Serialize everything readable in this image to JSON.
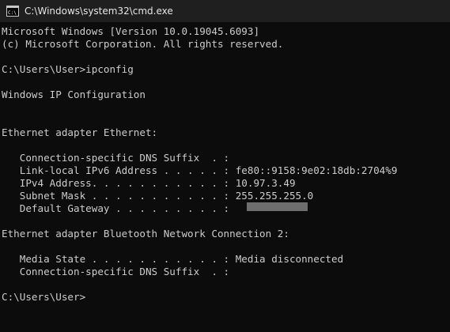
{
  "window": {
    "title": "C:\\Windows\\system32\\cmd.exe",
    "icon": "cmd-icon",
    "icon_label": "C:\\"
  },
  "console": {
    "lines": [
      "Microsoft Windows [Version 10.0.19045.6093]",
      "(c) Microsoft Corporation. All rights reserved.",
      "",
      "C:\\Users\\User>ipconfig",
      "",
      "Windows IP Configuration",
      "",
      "",
      "Ethernet adapter Ethernet:",
      "",
      "   Connection-specific DNS Suffix  . :",
      "   Link-local IPv6 Address . . . . . : fe80::9158:9e02:18db:2704%9",
      "   IPv4 Address. . . . . . . . . . . : 10.97.3.49",
      "   Subnet Mask . . . . . . . . . . . : 255.255.255.0",
      "   Default Gateway . . . . . . . . . :",
      "",
      "Ethernet adapter Bluetooth Network Connection 2:",
      "",
      "   Media State . . . . . . . . . . . : Media disconnected",
      "   Connection-specific DNS Suffix  . :",
      "",
      "C:\\Users\\User>"
    ],
    "text_color": "#cccccc",
    "background_color": "#0c0c0c"
  }
}
